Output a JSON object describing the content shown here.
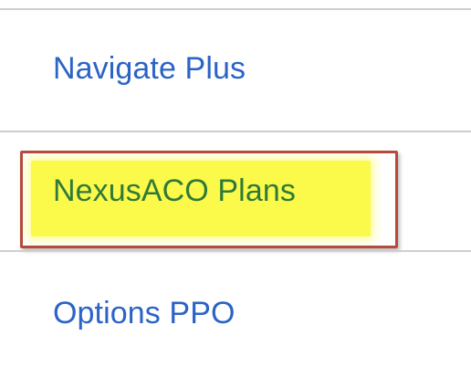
{
  "nav": {
    "items": [
      {
        "label": "Navigate Plus"
      },
      {
        "label": "NexusACO Plans"
      },
      {
        "label": "Options PPO"
      }
    ]
  },
  "colors": {
    "link": "#2b63c6",
    "highlighted_link_text": "#2f7a38",
    "highlight_fill": "#fbf94a",
    "highlight_border": "#b54a3d",
    "divider": "#cfcfcf"
  }
}
